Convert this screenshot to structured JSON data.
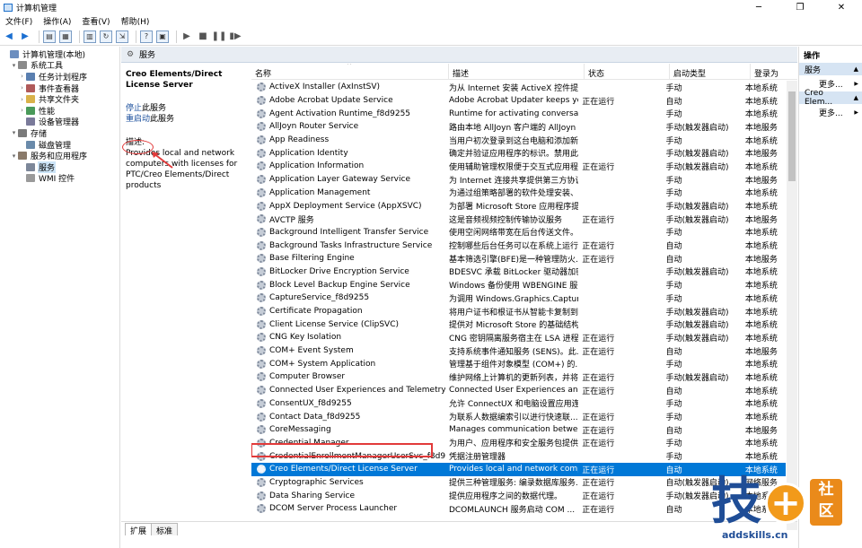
{
  "window": {
    "title": "计算机管理",
    "minimize": "─",
    "maximize": "❐",
    "close": "✕"
  },
  "menu": [
    "文件(F)",
    "操作(A)",
    "查看(V)",
    "帮助(H)"
  ],
  "toolbar_icons": [
    "back-icon",
    "forward-icon",
    "folder-up-icon",
    "console-tree-icon",
    "properties-icon",
    "refresh-icon",
    "export-icon",
    "help-icon",
    "view-icon",
    "play-icon",
    "stop-icon",
    "pause-icon",
    "restart-icon"
  ],
  "tree": [
    {
      "label": "计算机管理(本地)",
      "arrow": "",
      "icon": "computer-icon",
      "level": 0
    },
    {
      "label": "系统工具",
      "arrow": "▾",
      "icon": "tools-icon",
      "level": 1
    },
    {
      "label": "任务计划程序",
      "arrow": "›",
      "icon": "task-scheduler-icon",
      "level": 2
    },
    {
      "label": "事件查看器",
      "arrow": "›",
      "icon": "event-viewer-icon",
      "level": 2
    },
    {
      "label": "共享文件夹",
      "arrow": "›",
      "icon": "shared-folder-icon",
      "level": 2
    },
    {
      "label": "性能",
      "arrow": "›",
      "icon": "performance-icon",
      "level": 2
    },
    {
      "label": "设备管理器",
      "arrow": "",
      "icon": "device-manager-icon",
      "level": 2
    },
    {
      "label": "存储",
      "arrow": "▾",
      "icon": "storage-icon",
      "level": 1
    },
    {
      "label": "磁盘管理",
      "arrow": "",
      "icon": "disk-icon",
      "level": 2
    },
    {
      "label": "服务和应用程序",
      "arrow": "▾",
      "icon": "services-apps-icon",
      "level": 1
    },
    {
      "label": "服务",
      "arrow": "",
      "icon": "services-icon",
      "level": 2,
      "selected": true
    },
    {
      "label": "WMI 控件",
      "arrow": "",
      "icon": "wmi-icon",
      "level": 2
    }
  ],
  "pane_title": "服务",
  "detail": {
    "service_name": "Creo Elements/Direct License Server",
    "stop_link": "停止",
    "stop_suffix": "此服务",
    "restart_link": "重启动",
    "restart_suffix": "此服务",
    "desc_label": "描述:",
    "desc_text": "Provides local and network computers with licenses for PTC/Creo Elements/Direct products"
  },
  "columns": {
    "name": "名称",
    "desc": "描述",
    "status": "状态",
    "start": "启动类型",
    "logon": "登录为",
    "sort_glyph": "^"
  },
  "services": [
    [
      "ActiveX Installer (AxInstSV)",
      "为从 Internet 安装 ActiveX 控件提供...",
      "",
      "手动",
      "本地系统"
    ],
    [
      "Adobe Acrobat Update Service",
      "Adobe Acrobat Updater keeps your...",
      "正在运行",
      "自动",
      "本地系统"
    ],
    [
      "Agent Activation Runtime_f8d9255",
      "Runtime for activating conversation...",
      "",
      "手动",
      "本地系统"
    ],
    [
      "AllJoyn Router Service",
      "路由本地 AllJoyn 客户端的 AllJoyn ...",
      "",
      "手动(触发器启动)",
      "本地服务"
    ],
    [
      "App Readiness",
      "当用户初次登录到这台电脑和添加新...",
      "",
      "手动",
      "本地系统"
    ],
    [
      "Application Identity",
      "确定并验证应用程序的标识。禁用此...",
      "",
      "手动(触发器启动)",
      "本地服务"
    ],
    [
      "Application Information",
      "使用辅助管理权限便于交互式应用程...",
      "正在运行",
      "手动(触发器启动)",
      "本地系统"
    ],
    [
      "Application Layer Gateway Service",
      "为 Internet 连接共享提供第三方协议...",
      "",
      "手动",
      "本地服务"
    ],
    [
      "Application Management",
      "为通过组策略部署的软件处理安装、...",
      "",
      "手动",
      "本地系统"
    ],
    [
      "AppX Deployment Service (AppXSVC)",
      "为部署 Microsoft Store 应用程序提供...",
      "",
      "手动(触发器启动)",
      "本地系统"
    ],
    [
      "AVCTP 服务",
      "这是音频视频控制传输协议服务",
      "正在运行",
      "手动(触发器启动)",
      "本地服务"
    ],
    [
      "Background Intelligent Transfer Service",
      "使用空闲网络带宽在后台传送文件。...",
      "",
      "手动",
      "本地系统"
    ],
    [
      "Background Tasks Infrastructure Service",
      "控制哪些后台任务可以在系统上运行...",
      "正在运行",
      "自动",
      "本地系统"
    ],
    [
      "Base Filtering Engine",
      "基本筛选引擎(BFE)是一种管理防火...",
      "正在运行",
      "自动",
      "本地服务"
    ],
    [
      "BitLocker Drive Encryption Service",
      "BDESVC 承载 BitLocker 驱动器加密...",
      "",
      "手动(触发器启动)",
      "本地系统"
    ],
    [
      "Block Level Backup Engine Service",
      "Windows 备份使用 WBENGINE 服务...",
      "",
      "手动",
      "本地系统"
    ],
    [
      "CaptureService_f8d9255",
      "为调用 Windows.Graphics.Capture ...",
      "",
      "手动",
      "本地系统"
    ],
    [
      "Certificate Propagation",
      "将用户证书和根证书从智能卡复制到...",
      "",
      "手动(触发器启动)",
      "本地系统"
    ],
    [
      "Client License Service (ClipSVC)",
      "提供对 Microsoft Store 的基础结构...",
      "",
      "手动(触发器启动)",
      "本地系统"
    ],
    [
      "CNG Key Isolation",
      "CNG 密钥隔离服务宿主在 LSA 进程...",
      "正在运行",
      "手动(触发器启动)",
      "本地系统"
    ],
    [
      "COM+ Event System",
      "支持系统事件通知服务 (SENS)。此...",
      "正在运行",
      "自动",
      "本地服务"
    ],
    [
      "COM+ System Application",
      "管理基于组件对象模型 (COM+) 的...",
      "",
      "手动",
      "本地系统"
    ],
    [
      "Computer Browser",
      "维护网络上计算机的更新列表，并将...",
      "正在运行",
      "手动(触发器启动)",
      "本地系统"
    ],
    [
      "Connected User Experiences and Telemetry",
      "Connected User Experiences and T...",
      "正在运行",
      "自动",
      "本地系统"
    ],
    [
      "ConsentUX_f8d9255",
      "允许 ConnectUX 和电脑设置应用连...",
      "",
      "手动",
      "本地系统"
    ],
    [
      "Contact Data_f8d9255",
      "为联系人数据编索引以进行快速联...",
      "正在运行",
      "手动",
      "本地系统"
    ],
    [
      "CoreMessaging",
      "Manages communication between ...",
      "正在运行",
      "自动",
      "本地服务"
    ],
    [
      "Credential Manager",
      "为用户、应用程序和安全服务包提供...",
      "正在运行",
      "手动",
      "本地系统"
    ],
    [
      "CredentialEnrollmentManagerUserSvc_f8d9255",
      "凭据注册管理器",
      "",
      "手动",
      "本地系统"
    ],
    [
      "Creo Elements/Direct License Server",
      "Provides local and network comput...",
      "正在运行",
      "自动",
      "本地系统"
    ],
    [
      "Cryptographic Services",
      "提供三种管理服务: 编录数据库服务...",
      "正在运行",
      "自动(触发器启动)",
      "网络服务"
    ],
    [
      "Data Sharing Service",
      "提供应用程序之间的数据代理。",
      "正在运行",
      "手动(触发器启动)",
      "本地系统"
    ],
    [
      "DCOM Server Process Launcher",
      "DCOMLAUNCH 服务启动 COM ...",
      "正在运行",
      "自动",
      "本地系统"
    ]
  ],
  "selected_index": 29,
  "tabs": [
    "扩展",
    "标准"
  ],
  "actions": {
    "header": "操作",
    "section1": "服务",
    "more1": "更多...",
    "section2": "Creo Elem...",
    "more2": "更多...",
    "collapse_glyph": "▲",
    "more_glyph": "▶"
  },
  "watermark": {
    "main": "技",
    "plus": "+",
    "badge_top": "社",
    "badge_bottom": "区",
    "url": "addskills.cn"
  }
}
